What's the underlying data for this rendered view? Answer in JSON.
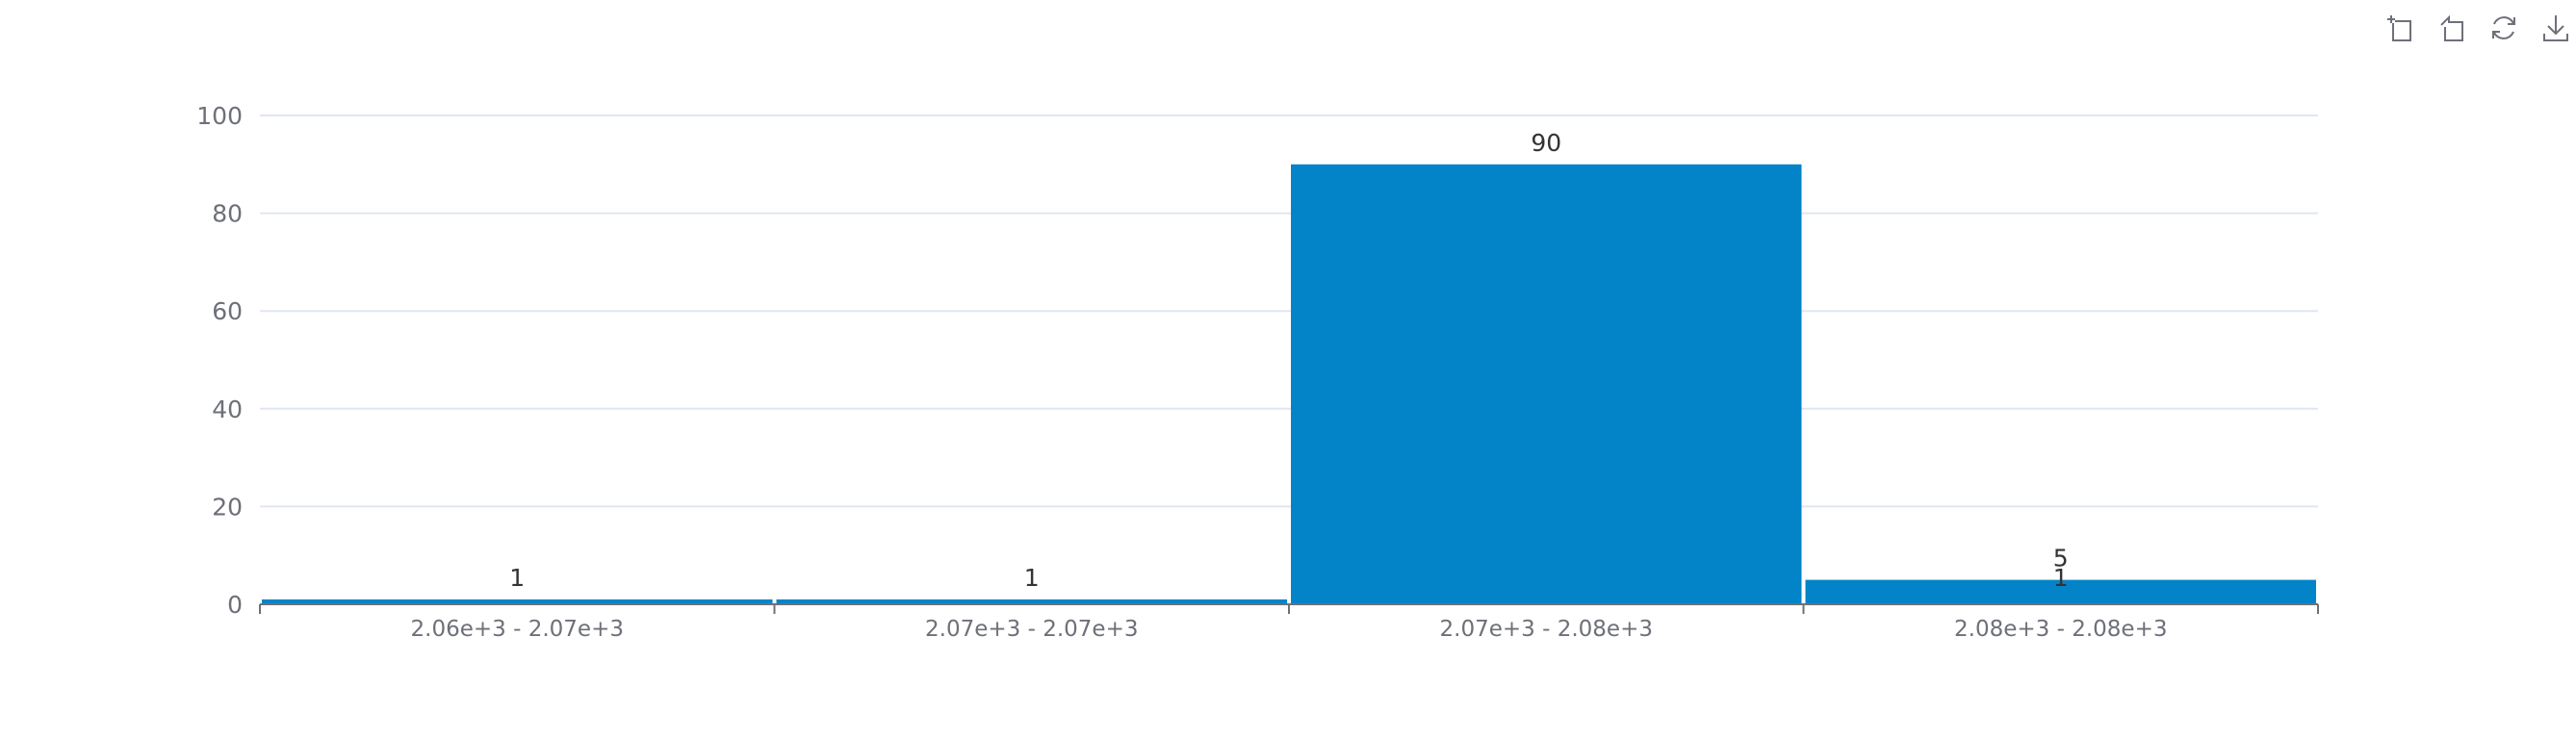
{
  "toolbox": {
    "items": [
      {
        "name": "zoom-select",
        "icon": "crop-icon"
      },
      {
        "name": "zoom-back",
        "icon": "undo-zoom-icon"
      },
      {
        "name": "restore",
        "icon": "refresh-icon"
      },
      {
        "name": "save-image",
        "icon": "download-icon"
      }
    ]
  },
  "colors": {
    "bar": "#0484c8",
    "grid": "#e0e6f1",
    "axis": "#6e7079",
    "label": "#333333"
  },
  "chart_data": {
    "type": "bar",
    "categories": [
      "2.06e+3 - 2.07e+3",
      "2.07e+3 - 2.07e+3",
      "2.07e+3 - 2.08e+3",
      "2.08e+3 - 2.08e+3"
    ],
    "series": [
      {
        "values": [
          1,
          1,
          90,
          5
        ]
      }
    ],
    "extra_labels": [
      {
        "category_index": 3,
        "value": 1
      }
    ],
    "yticks": [
      0,
      20,
      40,
      60,
      80,
      100
    ],
    "ylim": [
      0,
      100
    ],
    "grid": true,
    "title": "",
    "xlabel": "",
    "ylabel": ""
  }
}
